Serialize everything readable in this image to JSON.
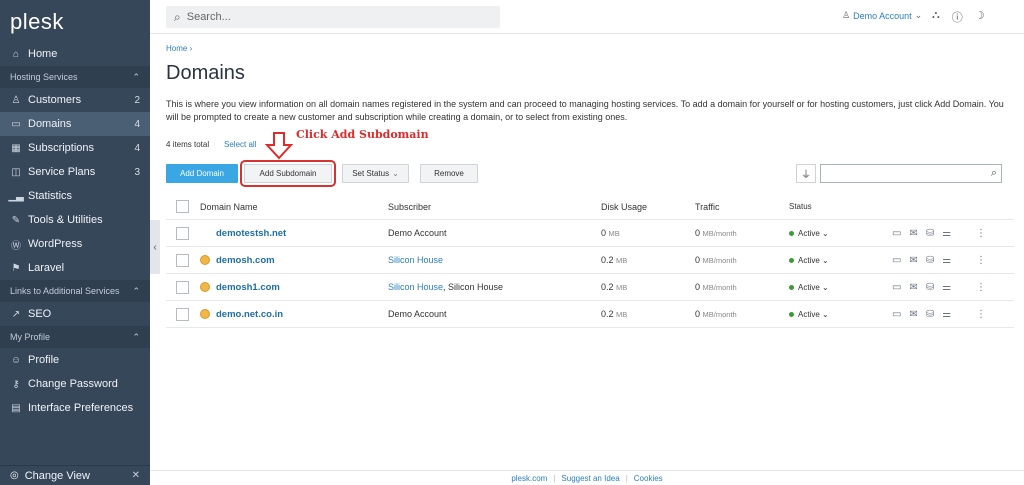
{
  "sidebar": {
    "logo": "plesk",
    "home": "Home",
    "sections": {
      "hosting": "Hosting Services",
      "links": "Links to Additional Services",
      "profile": "My Profile"
    },
    "hosting_items": [
      {
        "label": "Customers",
        "count": "2",
        "icon": "user-icon"
      },
      {
        "label": "Domains",
        "count": "4",
        "icon": "monitor-icon"
      },
      {
        "label": "Subscriptions",
        "count": "4",
        "icon": "grid-icon"
      },
      {
        "label": "Service Plans",
        "count": "3",
        "icon": "book-icon"
      },
      {
        "label": "Statistics",
        "count": "",
        "icon": "bar-chart-icon"
      },
      {
        "label": "Tools & Utilities",
        "count": "",
        "icon": "wrench-icon"
      },
      {
        "label": "WordPress",
        "count": "",
        "icon": "wordpress-icon"
      },
      {
        "label": "Laravel",
        "count": "",
        "icon": "laravel-icon"
      }
    ],
    "seo": "SEO",
    "profile_items": [
      {
        "label": "Profile",
        "icon": "profile-icon"
      },
      {
        "label": "Change Password",
        "icon": "key-icon"
      },
      {
        "label": "Interface Preferences",
        "icon": "preferences-icon"
      }
    ],
    "change_view": "Change View"
  },
  "topbar": {
    "search_placeholder": "Search...",
    "account": "Demo Account"
  },
  "main": {
    "breadcrumb": "Home",
    "title": "Domains",
    "description": "This is where you view information on all domain names registered in the system and can proceed to managing hosting services. To add a domain for yourself or for hosting customers, just click Add Domain. You will be prompted to create a new customer and subscription while creating a domain, or to select from existing ones.",
    "total": "4 items total",
    "select_all": "Select all",
    "annotation": "Click Add Subdomain",
    "buttons": {
      "add_domain": "Add Domain",
      "add_subdomain": "Add Subdomain",
      "set_status": "Set Status",
      "remove": "Remove"
    },
    "columns": {
      "domain": "Domain Name",
      "subscriber": "Subscriber",
      "disk": "Disk Usage",
      "traffic": "Traffic",
      "status": "Status"
    },
    "rows": [
      {
        "domain": "demotestsh.net",
        "subscriber": "Demo Account",
        "subscriber_link": "",
        "subscriber_extra": "",
        "disk": "0",
        "disk_unit": "MB",
        "traffic": "0",
        "traffic_unit": "MB/month",
        "status": "Active",
        "icon": false
      },
      {
        "domain": "demosh.com",
        "subscriber": "",
        "subscriber_link": "Silicon House",
        "subscriber_extra": "",
        "disk": "0.2",
        "disk_unit": "MB",
        "traffic": "0",
        "traffic_unit": "MB/month",
        "status": "Active",
        "icon": true
      },
      {
        "domain": "demosh1.com",
        "subscriber": "",
        "subscriber_link": "Silicon House",
        "subscriber_extra": ", Silicon House",
        "disk": "0.2",
        "disk_unit": "MB",
        "traffic": "0",
        "traffic_unit": "MB/month",
        "status": "Active",
        "icon": true
      },
      {
        "domain": "demo.net.co.in",
        "subscriber": "Demo Account",
        "subscriber_link": "",
        "subscriber_extra": "",
        "disk": "0.2",
        "disk_unit": "MB",
        "traffic": "0",
        "traffic_unit": "MB/month",
        "status": "Active",
        "icon": true
      }
    ]
  },
  "footer": {
    "links": [
      "plesk.com",
      "Suggest an Idea",
      "Cookies"
    ]
  }
}
